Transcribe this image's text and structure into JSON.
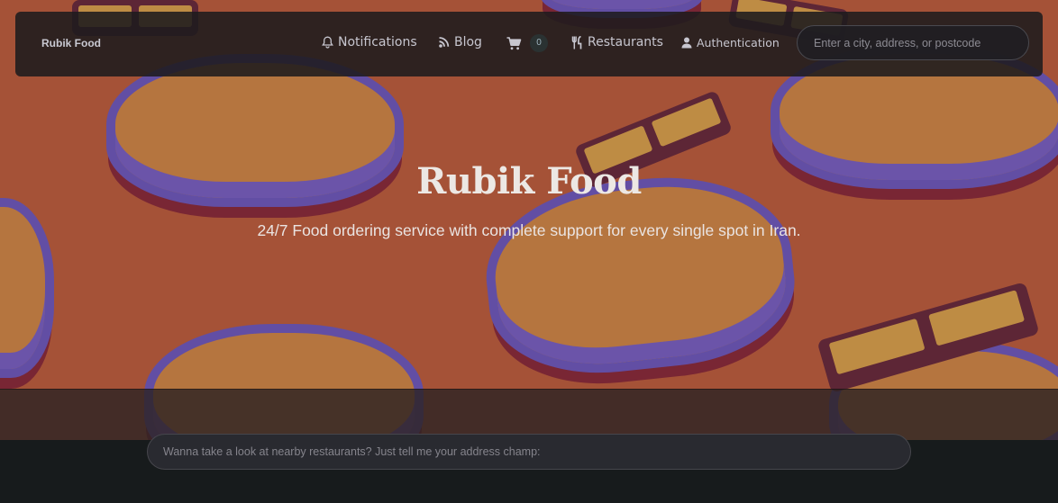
{
  "brand": "Rubik Food",
  "nav": {
    "notifications_label": "Notifications",
    "blog_label": "Blog",
    "cart_count": "0",
    "restaurants_label": "Restaurants",
    "authentication_label": "Authentication"
  },
  "search": {
    "placeholder": "Enter a city, address, or postcode",
    "value": ""
  },
  "hero": {
    "title": "Rubik Food",
    "subtitle": "24/7 Food ordering service with complete support for every single spot in Iran."
  },
  "address_input": {
    "placeholder": "Wanna take a look at nearby restaurants? Just tell me your address champ:",
    "value": ""
  },
  "icons": {
    "notifications": "bell-icon",
    "blog": "rss-icon",
    "cart": "shopping-cart-icon",
    "restaurants": "utensils-icon",
    "authentication": "user-icon"
  },
  "colors": {
    "hero_background": "#c1603d",
    "navbar_background": "#1e1b1e",
    "page_background": "#171b1c",
    "text": "#c7c6cf"
  }
}
